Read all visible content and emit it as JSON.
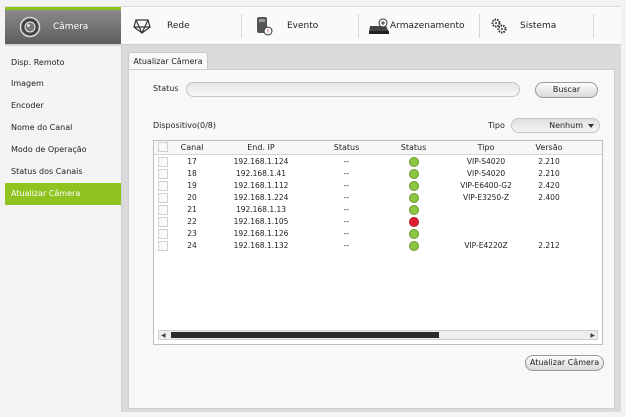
{
  "nav": {
    "items": [
      {
        "label": "Câmera",
        "icon": "camera-icon",
        "active": true
      },
      {
        "label": "Rede",
        "icon": "network-icon",
        "active": false
      },
      {
        "label": "Evento",
        "icon": "event-icon",
        "active": false
      },
      {
        "label": "Armazenamento",
        "icon": "storage-icon",
        "active": false
      },
      {
        "label": "Sistema",
        "icon": "gears-icon",
        "active": false
      }
    ]
  },
  "sidebar": {
    "items": [
      {
        "label": "Disp. Remoto"
      },
      {
        "label": "Imagem"
      },
      {
        "label": "Encoder"
      },
      {
        "label": "Nome do Canal"
      },
      {
        "label": "Modo de Operação"
      },
      {
        "label": "Status dos Canais"
      },
      {
        "label": "Atualizar Câmera",
        "active": true
      }
    ]
  },
  "main": {
    "tab": "Atualizar Câmera",
    "status_label": "Status",
    "status_value": "",
    "search_button": "Buscar",
    "device_count": "Dispositivo(0/8)",
    "type_label": "Tipo",
    "type_value": "Nenhum",
    "update_button": "Atualizar Câmera",
    "columns": [
      "Canal",
      "End. IP",
      "Status",
      "Status",
      "Tipo",
      "Versão"
    ],
    "rows": [
      {
        "canal": "17",
        "ip": "192.168.1.124",
        "status": "--",
        "dot": "green",
        "tipo": "VIP-S4020",
        "versao": "2.210"
      },
      {
        "canal": "18",
        "ip": "192.168.1.41",
        "status": "--",
        "dot": "green",
        "tipo": "VIP-S4020",
        "versao": "2.210"
      },
      {
        "canal": "19",
        "ip": "192.168.1.112",
        "status": "--",
        "dot": "green",
        "tipo": "VIP-E6400-G2",
        "versao": "2.420"
      },
      {
        "canal": "20",
        "ip": "192.168.1.224",
        "status": "--",
        "dot": "green",
        "tipo": "VIP-E3250-Z",
        "versao": "2.400"
      },
      {
        "canal": "21",
        "ip": "192.168.1.13",
        "status": "--",
        "dot": "green",
        "tipo": "",
        "versao": ""
      },
      {
        "canal": "22",
        "ip": "192.168.1.105",
        "status": "--",
        "dot": "red",
        "tipo": "",
        "versao": ""
      },
      {
        "canal": "23",
        "ip": "192.168.1.126",
        "status": "--",
        "dot": "green",
        "tipo": "",
        "versao": ""
      },
      {
        "canal": "24",
        "ip": "192.168.1.132",
        "status": "--",
        "dot": "green",
        "tipo": "VIP-E4220Z",
        "versao": "2.212"
      }
    ]
  },
  "colors": {
    "accent": "#8fc31f",
    "status_green": "#8cc63f",
    "status_red": "#e0202e"
  }
}
